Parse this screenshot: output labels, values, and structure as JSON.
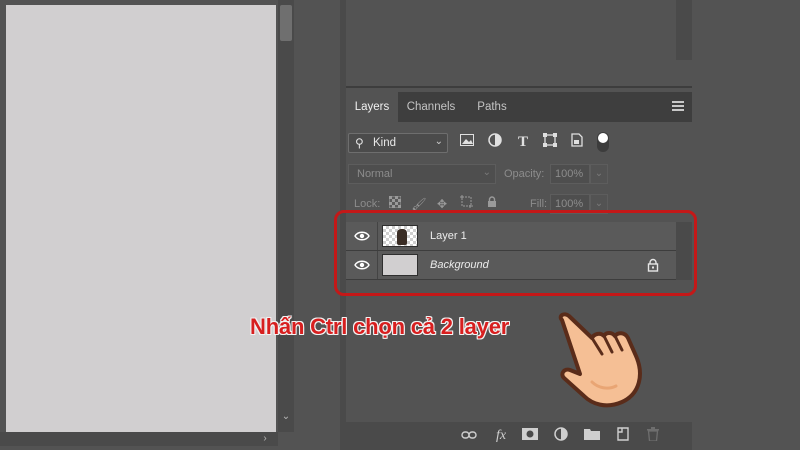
{
  "panel": {
    "tabs": [
      {
        "label": "Layers"
      },
      {
        "label": "Channels"
      },
      {
        "label": "Paths"
      }
    ],
    "filter": {
      "kind_label": "Kind"
    },
    "blend": {
      "mode": "Normal",
      "opacity_label": "Opacity:",
      "opacity_value": "100%"
    },
    "lock": {
      "label": "Lock:",
      "fill_label": "Fill:",
      "fill_value": "100%"
    },
    "layers": [
      {
        "name": "Layer 1",
        "visible": true,
        "selected": true
      },
      {
        "name": "Background",
        "visible": true,
        "locked": true,
        "selected": true
      }
    ]
  },
  "annotation": {
    "text": "Nhấn Ctrl chọn cả 2 layer",
    "color": "#d71f1f"
  },
  "colors": {
    "panel_bg": "#535353",
    "canvas": "#d1cfd0",
    "highlight": "#c41818"
  }
}
